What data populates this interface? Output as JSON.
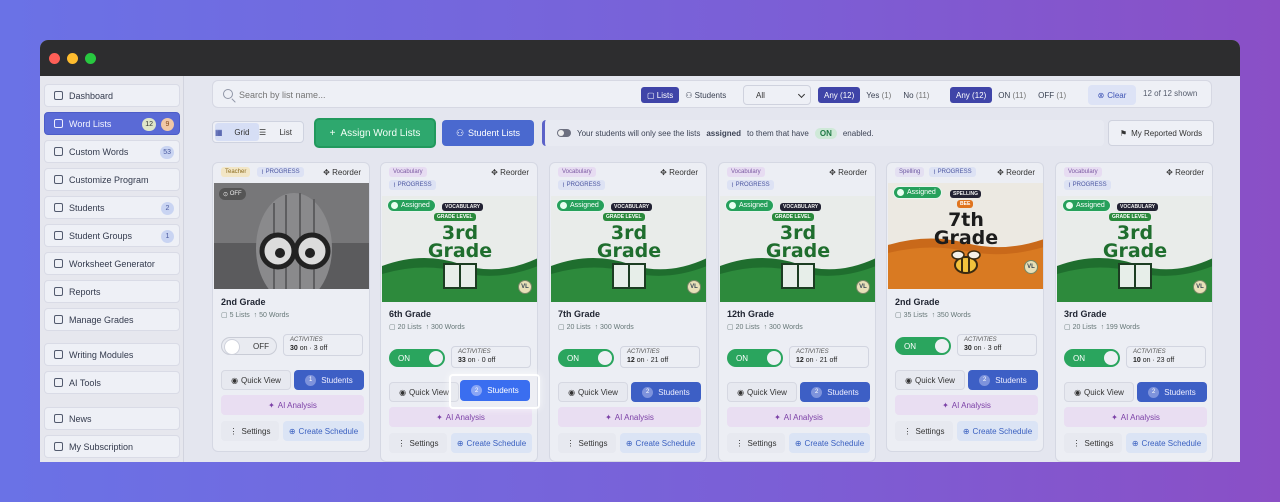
{
  "sidebar": {
    "items": [
      {
        "label": "Dashboard"
      },
      {
        "label": "Word Lists",
        "badges": [
          "12",
          "9"
        ]
      },
      {
        "label": "Custom Words",
        "badges": [
          "53"
        ]
      },
      {
        "label": "Customize Program"
      },
      {
        "label": "Students",
        "badges": [
          "2"
        ]
      },
      {
        "label": "Student Groups",
        "badges": [
          "1"
        ]
      },
      {
        "label": "Worksheet Generator"
      },
      {
        "label": "Reports"
      },
      {
        "label": "Manage Grades"
      },
      {
        "label": "Writing Modules"
      },
      {
        "label": "AI Tools"
      },
      {
        "label": "News"
      },
      {
        "label": "My Subscription"
      }
    ]
  },
  "filters": {
    "search_placeholder": "Search by list name...",
    "type_lists": "Lists",
    "type_students": "Students",
    "select_value": "All",
    "assigned": {
      "any": "Any",
      "any_count": "(12)",
      "yes": "Yes",
      "yes_count": "(1)",
      "no": "No",
      "no_count": "(11)"
    },
    "status": {
      "any": "Any",
      "any_count": "(12)",
      "on": "ON",
      "on_count": "(11)",
      "off": "OFF",
      "off_count": "(1)"
    },
    "clear": "Clear",
    "shown": "12 of 12 shown"
  },
  "toolbar": {
    "grid": "Grid",
    "list": "List",
    "assign": "Assign Word Lists",
    "student_lists": "Student Lists",
    "info_pre": "Your students will only see the lists",
    "info_bold": "assigned",
    "info_post": "to them that have",
    "info_on": "ON",
    "info_end": "enabled.",
    "reported": "My Reported Words"
  },
  "common": {
    "reorder": "Reorder",
    "progress": "PROGRESS",
    "assigned": "Assigned",
    "vocabulary_tag": "VOCABULARY",
    "grade_level_tag": "GRADE LEVEL",
    "spelling_tag": "SPELLING",
    "bee_tag": "BEE",
    "vl": "VL",
    "activities": "ACTIVITIES",
    "quick_view": "Quick View",
    "students": "Students",
    "ai_analysis": "AI Analysis",
    "settings": "Settings",
    "create_schedule": "Create Schedule",
    "off_badge": "OFF"
  },
  "cards": [
    {
      "category": "Teacher",
      "name": "2nd Grade",
      "lists": "5 Lists",
      "words": "50 Words",
      "state": "OFF",
      "activities_on": "30",
      "activities_off": "3",
      "students": "1"
    },
    {
      "category": "Vocabulary",
      "thumb_line1": "3rd",
      "thumb_line2": "Grade",
      "name": "6th Grade",
      "lists": "20 Lists",
      "words": "300 Words",
      "state": "ON",
      "activities_on": "33",
      "activities_off": "0",
      "students": "2"
    },
    {
      "category": "Vocabulary",
      "thumb_line1": "3rd",
      "thumb_line2": "Grade",
      "name": "7th Grade",
      "lists": "20 Lists",
      "words": "300 Words",
      "state": "ON",
      "activities_on": "12",
      "activities_off": "21",
      "students": "2"
    },
    {
      "category": "Vocabulary",
      "thumb_line1": "3rd",
      "thumb_line2": "Grade",
      "name": "12th Grade",
      "lists": "20 Lists",
      "words": "300 Words",
      "state": "ON",
      "activities_on": "12",
      "activities_off": "21",
      "students": "2"
    },
    {
      "category": "Spelling",
      "thumb_line1": "7th",
      "thumb_line2": "Grade",
      "name": "2nd Grade",
      "lists": "35 Lists",
      "words": "350 Words",
      "state": "ON",
      "activities_on": "30",
      "activities_off": "3",
      "students": "2"
    },
    {
      "category": "Vocabulary",
      "thumb_line1": "3rd",
      "thumb_line2": "Grade",
      "name": "3rd Grade",
      "lists": "20 Lists",
      "words": "199 Words",
      "state": "ON",
      "activities_on": "10",
      "activities_off": "23",
      "students": "2"
    }
  ],
  "colors": {
    "accent": "#4a69cf",
    "green": "#2aa55e",
    "ai_purple": "#7b3fa6",
    "sidebar_active": "#5a6ad6"
  }
}
